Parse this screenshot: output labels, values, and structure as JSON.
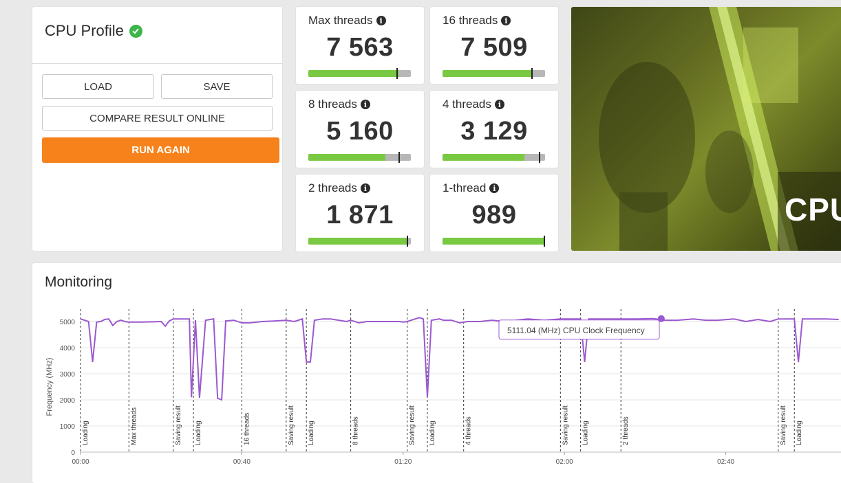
{
  "profile": {
    "title": "CPU Profile",
    "load_label": "LOAD",
    "save_label": "SAVE",
    "compare_label": "COMPARE RESULT ONLINE",
    "run_label": "RUN AGAIN"
  },
  "scores": [
    {
      "label": "Max threads",
      "value": "7 563",
      "fill": 0.88,
      "marker": 0.87
    },
    {
      "label": "16 threads",
      "value": "7 509",
      "fill": 0.87,
      "marker": 0.88
    },
    {
      "label": "8 threads",
      "value": "5 160",
      "fill": 0.75,
      "marker": 0.89
    },
    {
      "label": "4 threads",
      "value": "3 129",
      "fill": 0.8,
      "marker": 0.95
    },
    {
      "label": "2 threads",
      "value": "1 871",
      "fill": 0.96,
      "marker": 0.97
    },
    {
      "label": "1-thread",
      "value": "989",
      "fill": 1.0,
      "marker": 1.0
    }
  ],
  "hero": {
    "text": "CPU"
  },
  "monitoring": {
    "title": "Monitoring",
    "tooltip": "5111.04 (MHz) CPU Clock Frequency"
  },
  "colors": {
    "accent": "#f7821b",
    "bar_fill": "#7ac943",
    "line": "#9b59d0",
    "check": "#3cb54a"
  },
  "chart_data": {
    "type": "line",
    "ylabel": "Frequency (MHz)",
    "ylim": [
      0,
      5000
    ],
    "yticks": [
      0,
      1000,
      2000,
      3000,
      4000,
      5000
    ],
    "xticks": [
      "00:00",
      "00:40",
      "01:20",
      "02:00",
      "02:40"
    ],
    "x_unit": "seconds",
    "markers": [
      {
        "t": 0,
        "label": "Loading"
      },
      {
        "t": 12,
        "label": "Max threads"
      },
      {
        "t": 23,
        "label": "Saving result"
      },
      {
        "t": 28,
        "label": "Loading"
      },
      {
        "t": 40,
        "label": "16 threads"
      },
      {
        "t": 51,
        "label": "Saving result"
      },
      {
        "t": 56,
        "label": "Loading"
      },
      {
        "t": 67,
        "label": "8 threads"
      },
      {
        "t": 81,
        "label": "Saving result"
      },
      {
        "t": 86,
        "label": "Loading"
      },
      {
        "t": 95,
        "label": "4 threads"
      },
      {
        "t": 119,
        "label": "Saving result"
      },
      {
        "t": 124,
        "label": "Loading"
      },
      {
        "t": 134,
        "label": "2 threads"
      },
      {
        "t": 173,
        "label": "Saving result"
      },
      {
        "t": 177,
        "label": "Loading"
      }
    ],
    "series": [
      {
        "values": [
          [
            0,
            5100
          ],
          [
            1,
            5050
          ],
          [
            2,
            5000
          ],
          [
            3,
            3450
          ],
          [
            4,
            4980
          ],
          [
            5,
            5000
          ],
          [
            6,
            5080
          ],
          [
            7,
            5100
          ],
          [
            8,
            4850
          ],
          [
            9,
            5000
          ],
          [
            10,
            5050
          ],
          [
            11,
            5000
          ],
          [
            12,
            4980
          ],
          [
            15,
            4980
          ],
          [
            18,
            4990
          ],
          [
            20,
            5000
          ],
          [
            21,
            4820
          ],
          [
            22,
            5020
          ],
          [
            23,
            5100
          ],
          [
            25,
            5100
          ],
          [
            27,
            5100
          ],
          [
            27.5,
            2100
          ],
          [
            28.5,
            5050
          ],
          [
            29.5,
            2080
          ],
          [
            31,
            5050
          ],
          [
            33,
            5100
          ],
          [
            34,
            2060
          ],
          [
            35,
            2000
          ],
          [
            36,
            5020
          ],
          [
            38,
            5050
          ],
          [
            40,
            4950
          ],
          [
            42,
            4950
          ],
          [
            45,
            5000
          ],
          [
            48,
            5020
          ],
          [
            51,
            5050
          ],
          [
            53,
            5000
          ],
          [
            55,
            5100
          ],
          [
            56,
            3450
          ],
          [
            57,
            3450
          ],
          [
            58,
            5050
          ],
          [
            60,
            5100
          ],
          [
            62,
            5100
          ],
          [
            64,
            5050
          ],
          [
            66,
            5000
          ],
          [
            67,
            5050
          ],
          [
            69,
            4950
          ],
          [
            71,
            5000
          ],
          [
            73,
            5000
          ],
          [
            76,
            5000
          ],
          [
            79,
            5000
          ],
          [
            80,
            4980
          ],
          [
            81,
            5000
          ],
          [
            83,
            5100
          ],
          [
            84,
            5150
          ],
          [
            85,
            5100
          ],
          [
            86,
            2100
          ],
          [
            87,
            5050
          ],
          [
            89,
            5100
          ],
          [
            90,
            5050
          ],
          [
            92,
            5050
          ],
          [
            94,
            4950
          ],
          [
            96,
            5000
          ],
          [
            99,
            5000
          ],
          [
            102,
            5050
          ],
          [
            105,
            5000
          ],
          [
            108,
            5050
          ],
          [
            111,
            5100
          ],
          [
            115,
            5050
          ],
          [
            119,
            5100
          ],
          [
            122,
            5100
          ],
          [
            124,
            5100
          ],
          [
            125,
            3450
          ],
          [
            126,
            5100
          ],
          [
            129,
            5100
          ],
          [
            132,
            5100
          ],
          [
            135,
            5100
          ],
          [
            138,
            5100
          ],
          [
            142,
            5110
          ],
          [
            145,
            5050
          ],
          [
            148,
            5050
          ],
          [
            152,
            5100
          ],
          [
            155,
            5050
          ],
          [
            158,
            5050
          ],
          [
            162,
            5100
          ],
          [
            165,
            5000
          ],
          [
            168,
            5080
          ],
          [
            171,
            5000
          ],
          [
            173,
            5100
          ],
          [
            176,
            5100
          ],
          [
            177,
            5100
          ],
          [
            178,
            3450
          ],
          [
            179,
            5100
          ],
          [
            181,
            5100
          ],
          [
            185,
            5100
          ],
          [
            188,
            5080
          ]
        ]
      }
    ]
  }
}
